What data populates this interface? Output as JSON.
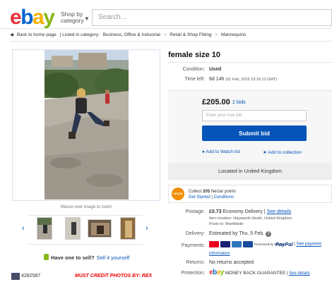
{
  "header": {
    "logo_letters": [
      "e",
      "b",
      "a",
      "y"
    ],
    "shop_by_line1": "Shop by",
    "shop_by_line2": "category",
    "search_placeholder": "Search..."
  },
  "breadcrumb": {
    "back": "Back to home page",
    "listed_in": "| Listed in category:",
    "items": [
      "Business, Office & Industrial",
      "Retail & Shop Fitting",
      "Mannequins"
    ],
    "separator": ">"
  },
  "gallery": {
    "zoom_hint": "Mouse over image to zoom"
  },
  "sell": {
    "question": "Have one to sell?",
    "link": "Sell it yourself"
  },
  "footer": {
    "left": "4282587",
    "red": "MUST CREDIT PHOTOS BY: REX"
  },
  "item": {
    "title": "female size 10",
    "condition_label": "Condition:",
    "condition_value": "Used",
    "time_left_label": "Time left:",
    "time_left_value": "6d 14h",
    "time_left_date": "(01 Feb, 2015 23:16:13 GMT)"
  },
  "bid": {
    "price": "£205.00",
    "bids": "2 bids",
    "max_bid_placeholder": "Enter your max bid",
    "submit": "Submit bid",
    "watch": "Add to Watch list",
    "collection": "Add to collection"
  },
  "location": "Located in United Kingdom",
  "nectar": {
    "logo": "nectar",
    "line1_pre": "Collect ",
    "points": "205",
    "line1_post": " Nectar points",
    "line2_a": "Get Started",
    "line2_sep": " | ",
    "line2_b": "Conditions"
  },
  "postage": {
    "label": "Postage:",
    "price": "£0.73",
    "service": "Economy Delivery",
    "sep": " | ",
    "details": "See details",
    "item_location": "Item location: Haywards Heath, United Kingdom",
    "posts_to": "Posts to: Worldwide"
  },
  "delivery": {
    "label": "Delivery:",
    "value": "Estimated by Thu. 5 Feb."
  },
  "payments": {
    "label": "Payments:",
    "processed": "Processed by PayPal",
    "paypal": "PayPal",
    "sep": " | ",
    "details": "See payment",
    "info": "information"
  },
  "returns": {
    "label": "Returns:",
    "value": "No returns accepted"
  },
  "protection": {
    "label": "Protection:",
    "value": "MONEY BACK GUARANTEE",
    "sep": " | ",
    "details": "See details"
  },
  "colors": {
    "ebay_red": "#e53238",
    "ebay_blue": "#0064d2",
    "ebay_yellow": "#f5af02",
    "ebay_green": "#86b817",
    "link_blue": "#0654ba"
  }
}
